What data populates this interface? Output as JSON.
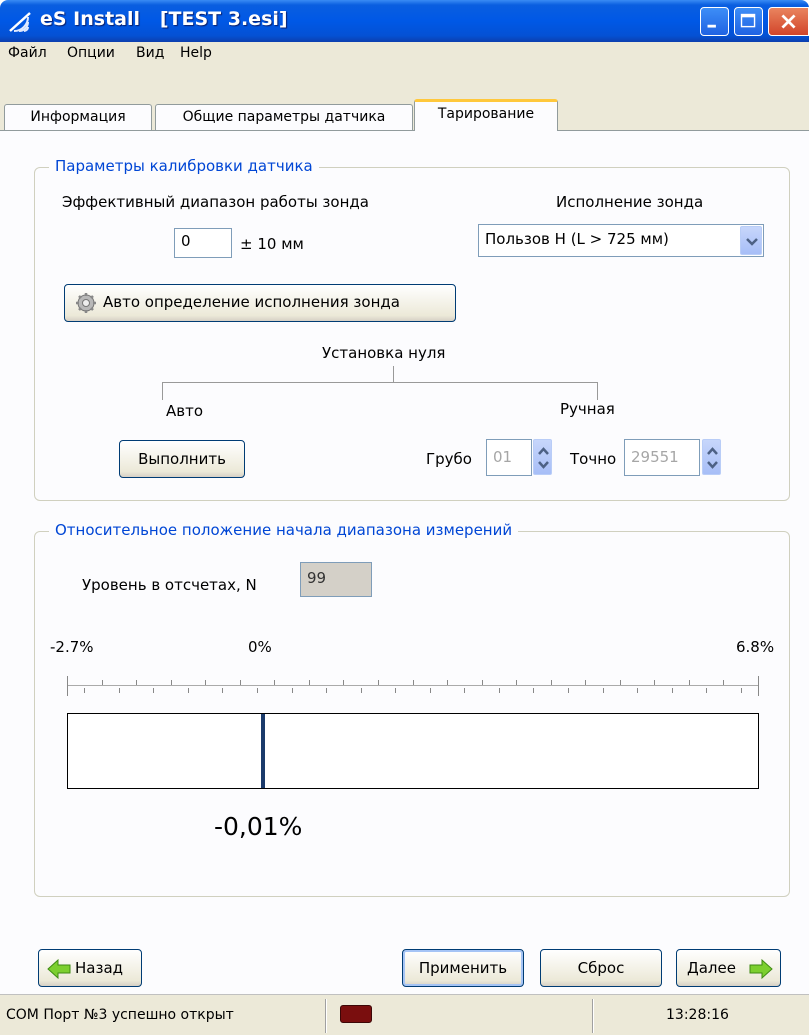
{
  "window": {
    "title": "eS Install   [TEST 3.esi]"
  },
  "menu": [
    "Файл",
    "Опции",
    "Вид",
    "Help"
  ],
  "tabs": [
    {
      "label": "Информация",
      "active": false
    },
    {
      "label": "Общие параметры датчика",
      "active": false
    },
    {
      "label": "Тарирование",
      "active": true
    }
  ],
  "calibration": {
    "group_title": "Параметры калибровки датчика",
    "range_label": "Эффективный диапазон работы зонда",
    "range_value": "0",
    "range_unit": "± 10 мм",
    "probe_label": "Исполнение зонда",
    "probe_selected": "Пользов Н (L > 725 мм)",
    "auto_detect_button": "Авто определение исполнения зонда",
    "zero_label": "Установка нуля",
    "auto_label": "Авто",
    "manual_label": "Ручная",
    "execute_button": "Выполнить",
    "coarse_label": "Грубо",
    "coarse_value": "01",
    "fine_label": "Точно",
    "fine_value": "29551"
  },
  "relative": {
    "group_title": "Относительное положение начала диапазона измерений",
    "level_label": "Уровень в отсчетах, N",
    "level_value": "99",
    "scale_min": "-2.7%",
    "scale_zero": "0%",
    "scale_max": "6.8%",
    "current_value": "-0,01%",
    "current_fraction": 0.283
  },
  "buttons": {
    "back": "Назад",
    "apply": "Применить",
    "reset": "Сброс",
    "next": "Далее"
  },
  "status": {
    "message": "COM Порт №3 успешно открыт",
    "time": "13:28:16",
    "led_color": "#7a0e0e"
  }
}
